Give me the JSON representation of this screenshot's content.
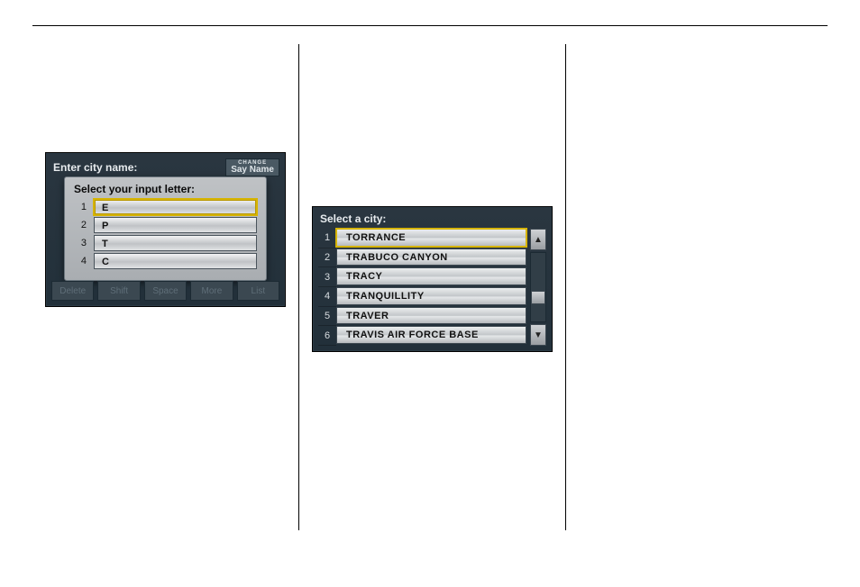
{
  "shot1": {
    "header": "Enter city name:",
    "sayName": {
      "change": "CHANGE",
      "label": "Say Name"
    },
    "popupTitle": "Select your input letter:",
    "options": [
      {
        "n": "1",
        "letter": "E",
        "selected": true
      },
      {
        "n": "2",
        "letter": "P",
        "selected": false
      },
      {
        "n": "3",
        "letter": "T",
        "selected": false
      },
      {
        "n": "4",
        "letter": "C",
        "selected": false
      }
    ],
    "bottom": [
      "Delete",
      "Shift",
      "Space",
      "More",
      "List"
    ]
  },
  "shot2": {
    "header": "Select a city:",
    "items": [
      {
        "n": "1",
        "label": "TORRANCE",
        "selected": true
      },
      {
        "n": "2",
        "label": "TRABUCO CANYON",
        "selected": false
      },
      {
        "n": "3",
        "label": "TRACY",
        "selected": false
      },
      {
        "n": "4",
        "label": "TRANQUILLITY",
        "selected": false
      },
      {
        "n": "5",
        "label": "TRAVER",
        "selected": false
      },
      {
        "n": "6",
        "label": "TRAVIS AIR FORCE BASE",
        "selected": false
      }
    ]
  }
}
